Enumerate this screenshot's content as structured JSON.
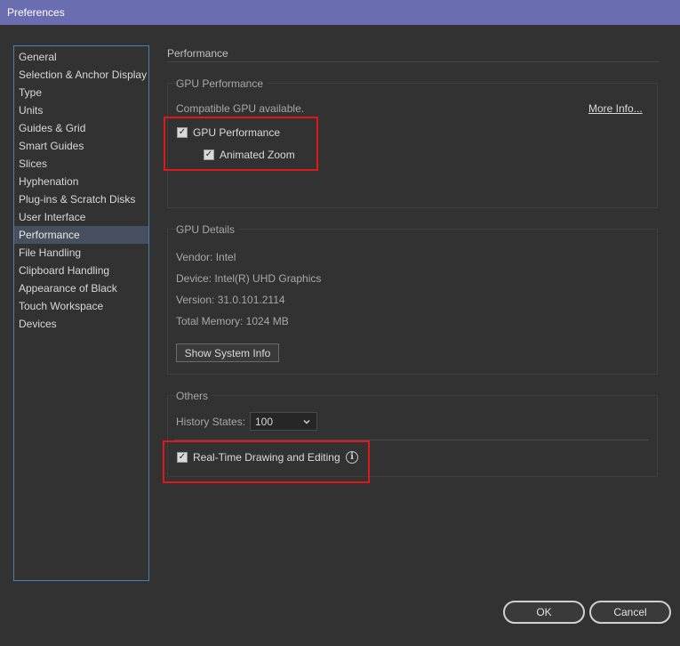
{
  "window": {
    "title": "Preferences"
  },
  "sidebar": {
    "items": [
      {
        "label": "General"
      },
      {
        "label": "Selection & Anchor Display"
      },
      {
        "label": "Type"
      },
      {
        "label": "Units"
      },
      {
        "label": "Guides & Grid"
      },
      {
        "label": "Smart Guides"
      },
      {
        "label": "Slices"
      },
      {
        "label": "Hyphenation"
      },
      {
        "label": "Plug-ins & Scratch Disks"
      },
      {
        "label": "User Interface"
      },
      {
        "label": "Performance",
        "selected": true
      },
      {
        "label": "File Handling"
      },
      {
        "label": "Clipboard Handling"
      },
      {
        "label": "Appearance of Black"
      },
      {
        "label": "Touch Workspace"
      },
      {
        "label": "Devices"
      }
    ]
  },
  "main": {
    "section_title": "Performance",
    "gpu_performance": {
      "label": "GPU Performance",
      "status": "Compatible GPU available.",
      "more_info_link": "More Info...",
      "gpu_performance_checkbox": {
        "label": "GPU Performance",
        "checked": true
      },
      "animated_zoom_checkbox": {
        "label": "Animated Zoom",
        "checked": true
      }
    },
    "gpu_details": {
      "label": "GPU Details",
      "vendor": "Vendor: Intel",
      "device": "Device: Intel(R) UHD Graphics",
      "version": "Version: 31.0.101.2114",
      "memory": "Total Memory: 1024 MB",
      "show_system_info_button": "Show System Info"
    },
    "others": {
      "label": "Others",
      "history_states_label": "History States:",
      "history_states_value": "100",
      "realtime_checkbox": {
        "label": "Real-Time Drawing and Editing",
        "checked": true
      }
    }
  },
  "footer": {
    "ok_button": "OK",
    "cancel_button": "Cancel"
  },
  "colors": {
    "title_bar": "#6a6eb0",
    "highlight_box": "#e01818",
    "sidebar_border": "#4a7fb0",
    "selected_item": "#46505e"
  },
  "icons": {
    "checkbox_check": "check-icon",
    "dropdown": "chevron-down-icon",
    "info": "info-icon"
  }
}
